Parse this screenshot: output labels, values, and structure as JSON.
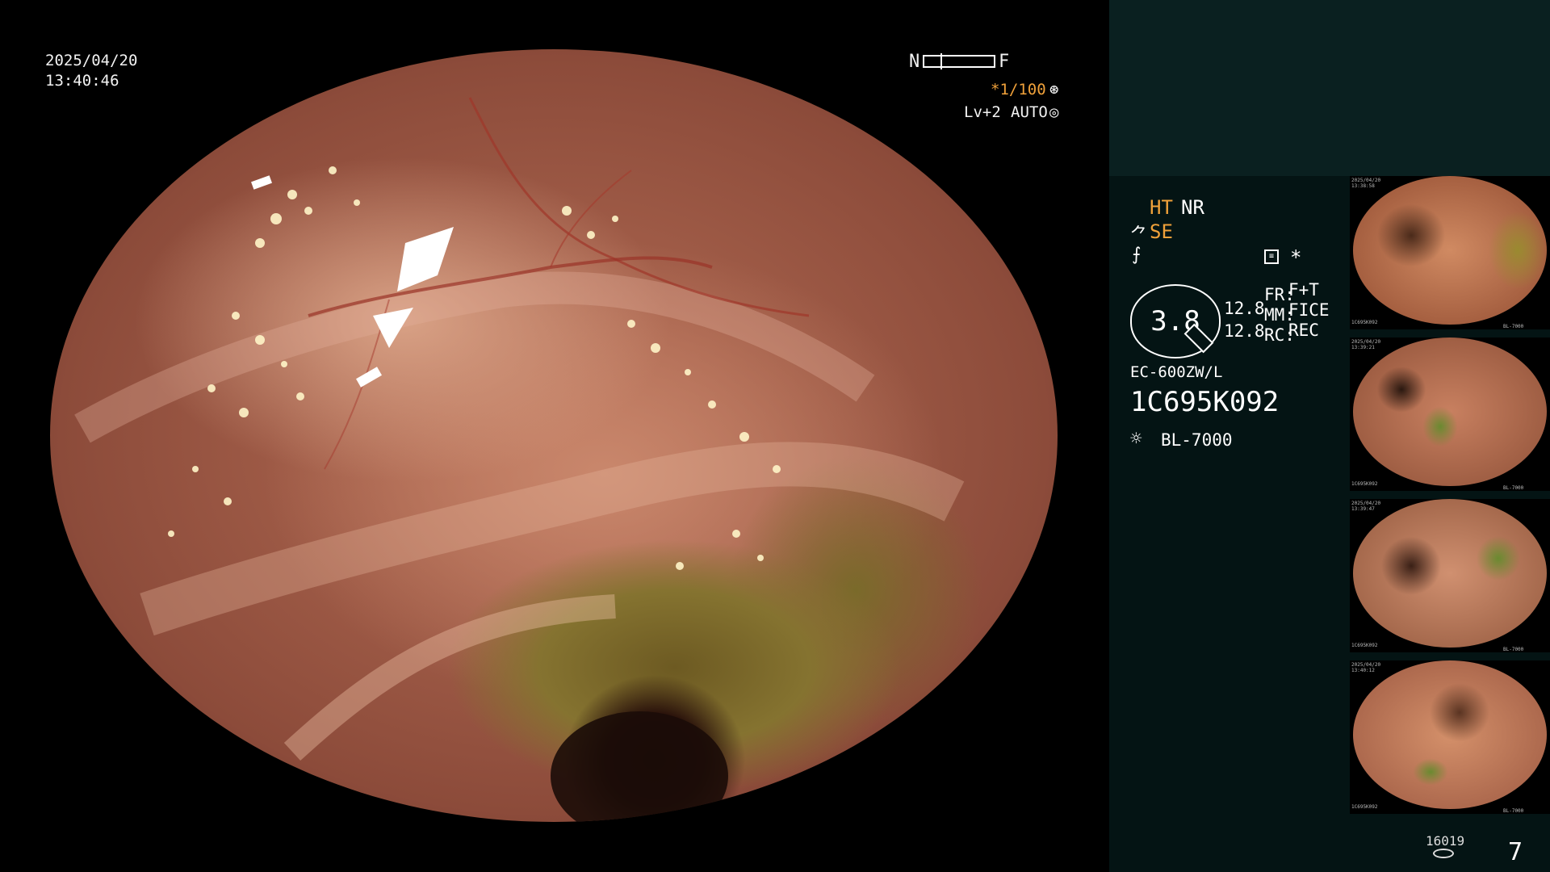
{
  "overlay": {
    "date": "2025/04/20",
    "time": "13:40:46",
    "near_label": "N",
    "far_label": "F",
    "shutter": "*1/100",
    "level": "Lv+2",
    "iris": "AUTO"
  },
  "panel": {
    "modes": {
      "ht": "HT",
      "nr": "NR",
      "se": "SE"
    },
    "asterisk": "*",
    "zoom_value": "3.8",
    "value_1": "12.8",
    "value_2": "12.8",
    "fr_label": "FR:",
    "fr_value": "F+T",
    "mm_label": "MM:",
    "mm_value": "FICE",
    "rc_label": "RC:",
    "rc_value": "REC",
    "scope_model": "EC-600ZW/L",
    "scope_serial": "1C695K092",
    "light_source": "BL-7000",
    "storage_count": "16019",
    "image_count": "7"
  },
  "thumbnails": [
    {
      "date": "2025/04/20",
      "time": "13:38:58",
      "serial": "1C695K092",
      "light": "BL-7000"
    },
    {
      "date": "2025/04/20",
      "time": "13:39:21",
      "serial": "1C695K092",
      "light": "BL-7000"
    },
    {
      "date": "2025/04/20",
      "time": "13:39:47",
      "serial": "1C695K092",
      "light": "BL-7000"
    },
    {
      "date": "2025/04/20",
      "time": "13:40:12",
      "serial": "1C695K092",
      "light": "BL-7000"
    }
  ],
  "colors": {
    "accent_orange": "#f0a13a",
    "panel_top": "#0a2020",
    "panel_bottom": "#041414"
  }
}
